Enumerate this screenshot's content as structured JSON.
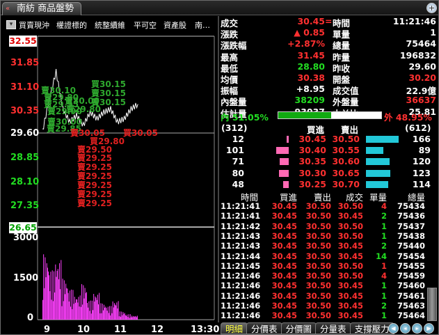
{
  "window": {
    "title": "南紡 商品盤勢"
  },
  "menu": [
    "買賣現沖",
    "權證標的",
    "統整續維",
    "平可空",
    "資產股",
    "南…"
  ],
  "price_axis": {
    "top": "32.55",
    "high": "31.85",
    "mid_high": "31.10",
    "upper": "30.35",
    "ref": "29.60",
    "lower": "28.85",
    "mid_low": "28.10",
    "low": "27.35",
    "bottom": "26.65"
  },
  "volume_axis": [
    "3000",
    "1500",
    "0"
  ],
  "time_axis": [
    "9",
    "10",
    "11",
    "12",
    "13:30"
  ],
  "chart_annotations": {
    "green": [
      "買30.15",
      "賣30.15",
      "賣30.15",
      "賣30.10",
      "賣29.80",
      "賣29.95",
      "賣30.00",
      "賣29.90",
      "賣30.00",
      "賣29.85",
      "賣29.80"
    ],
    "red": [
      "賣30.05",
      "賣29.50",
      "賣29.25",
      "賣29.25",
      "賣29.25",
      "賣29.25",
      "賣29.25",
      "賣29.25",
      "買29.80",
      "買30.05"
    ]
  },
  "chart_data": [
    {
      "type": "line",
      "title": "",
      "xlabel": "",
      "ylabel": "",
      "x": [
        "9:00",
        "9:10",
        "9:20",
        "9:30",
        "9:40",
        "9:50",
        "10:00",
        "10:10",
        "10:20",
        "10:30",
        "10:40",
        "10:50",
        "11:00",
        "11:10",
        "11:21"
      ],
      "series": [
        {
          "values": [
            29.6,
            30.6,
            31.45,
            30.3,
            29.9,
            30.1,
            29.8,
            30.2,
            30.0,
            30.2,
            30.3,
            29.9,
            30.0,
            30.3,
            30.45
          ]
        }
      ],
      "ylim": [
        26.65,
        32.55
      ],
      "ref": 29.6
    },
    {
      "type": "bar",
      "title": "",
      "xlabel": "",
      "ylabel": "",
      "x": [
        "9:00",
        "9:10",
        "9:20",
        "9:30",
        "9:40",
        "9:50",
        "10:00",
        "10:10",
        "10:20",
        "10:30",
        "10:40",
        "10:50",
        "11:00",
        "11:10",
        "11:20"
      ],
      "values": [
        2400,
        1800,
        2200,
        1500,
        1100,
        900,
        1300,
        700,
        1000,
        600,
        500,
        700,
        300,
        200,
        150
      ],
      "ylim": [
        0,
        3000
      ]
    }
  ],
  "quote": {
    "rows": [
      {
        "l1": "成交",
        "v1": "30.45",
        "c1": "red",
        "mark": "=",
        "l2": "時間",
        "v2": "11:21:46",
        "c2": "white"
      },
      {
        "l1": "漲跌",
        "v1": "▲ 0.85",
        "c1": "red",
        "l2": "單量",
        "v2": "1",
        "c2": "white"
      },
      {
        "l1": "漲跌幅",
        "v1": "+2.87%",
        "c1": "red",
        "l2": "總量",
        "v2": "75464",
        "c2": "white"
      },
      {
        "l1": "最高",
        "v1": "31.45",
        "c1": "red",
        "l2": "昨量",
        "v2": "196832",
        "c2": "white"
      },
      {
        "l1": "最低",
        "v1": "28.80",
        "c1": "green",
        "l2": "昨收",
        "v2": "29.60",
        "c2": "white"
      },
      {
        "l1": "均價",
        "v1": "30.38",
        "c1": "red",
        "l2": "開盤",
        "v2": "30.20",
        "c2": "red"
      },
      {
        "l1": "振幅",
        "v1": "+8.95",
        "c1": "white",
        "l2": "成交值",
        "v2": "22.9億",
        "c2": "white"
      },
      {
        "l1": "內盤量",
        "v1": "38209",
        "c1": "green",
        "l2": "外盤量",
        "v2": "36637",
        "c2": "red"
      },
      {
        "l1": "估計量",
        "v1": "93037",
        "c1": "white",
        "l2": "本益比",
        "v2": "25.81",
        "c2": "white"
      }
    ],
    "inner_ratio_label": "內 51.05%",
    "outer_ratio_label": "外 48.95%",
    "inner_ratio": 0.5105
  },
  "orderbook": {
    "bid_total": "(312)",
    "ask_total": "(612)",
    "bid_header": "買進",
    "ask_header": "賣出",
    "rows": [
      {
        "bq": "12",
        "bp": "30.45",
        "ap": "30.50",
        "aq": "166",
        "bqv": 12,
        "aqv": 166
      },
      {
        "bq": "101",
        "bp": "30.40",
        "ap": "30.55",
        "aq": "89",
        "bqv": 101,
        "aqv": 89
      },
      {
        "bq": "71",
        "bp": "30.35",
        "ap": "30.60",
        "aq": "120",
        "bqv": 71,
        "aqv": 120
      },
      {
        "bq": "80",
        "bp": "30.30",
        "ap": "30.65",
        "aq": "123",
        "bqv": 80,
        "aqv": 123
      },
      {
        "bq": "48",
        "bp": "30.25",
        "ap": "30.70",
        "aq": "114",
        "bqv": 48,
        "aqv": 114
      }
    ]
  },
  "ticks": {
    "headers": [
      "時間",
      "買進",
      "賣出",
      "成交",
      "單量",
      "總量"
    ],
    "rows": [
      [
        "11:21:41",
        "30.45",
        "30.50",
        "30.50",
        "4",
        "75434",
        "red"
      ],
      [
        "11:21:41",
        "30.45",
        "30.50",
        "30.45",
        "2",
        "75436",
        "green"
      ],
      [
        "11:21:42",
        "30.45",
        "30.50",
        "30.50",
        "1",
        "75437",
        "green"
      ],
      [
        "11:21:43",
        "30.45",
        "30.50",
        "30.50",
        "1",
        "75438",
        "green"
      ],
      [
        "11:21:43",
        "30.45",
        "30.50",
        "30.45",
        "2",
        "75440",
        "green"
      ],
      [
        "11:21:44",
        "30.45",
        "30.50",
        "30.45",
        "14",
        "75454",
        "green"
      ],
      [
        "11:21:45",
        "30.45",
        "30.50",
        "30.50",
        "1",
        "75455",
        "red"
      ],
      [
        "11:21:46",
        "30.45",
        "30.50",
        "30.50",
        "4",
        "75459",
        "red"
      ],
      [
        "11:21:46",
        "30.45",
        "30.50",
        "30.45",
        "1",
        "75460",
        "green"
      ],
      [
        "11:21:46",
        "30.45",
        "30.50",
        "30.45",
        "1",
        "75461",
        "green"
      ],
      [
        "11:21:46",
        "30.45",
        "30.50",
        "30.45",
        "2",
        "75463",
        "green"
      ],
      [
        "11:21:46",
        "30.45",
        "30.50",
        "30.45",
        "1",
        "75464",
        "green"
      ]
    ]
  },
  "tabs": [
    "明細",
    "分價表",
    "分價圖",
    "分量表",
    "支撐壓力"
  ]
}
